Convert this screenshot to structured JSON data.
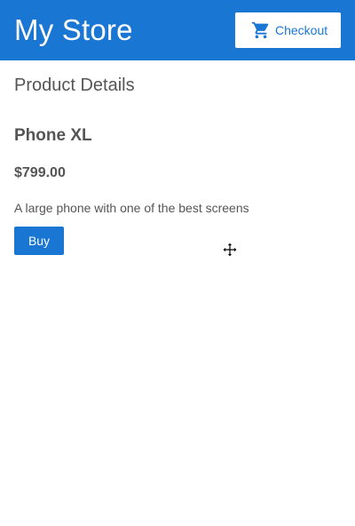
{
  "header": {
    "title": "My Store",
    "checkout_label": "Checkout",
    "checkout_icon": "shopping-cart-icon",
    "brand_color": "#1976d2"
  },
  "page": {
    "section_title": "Product Details"
  },
  "product": {
    "name": "Phone XL",
    "price": "$799.00",
    "description": "A large phone with one of the best screens",
    "buy_label": "Buy"
  },
  "cursor": {
    "icon": "move-cursor-icon"
  }
}
